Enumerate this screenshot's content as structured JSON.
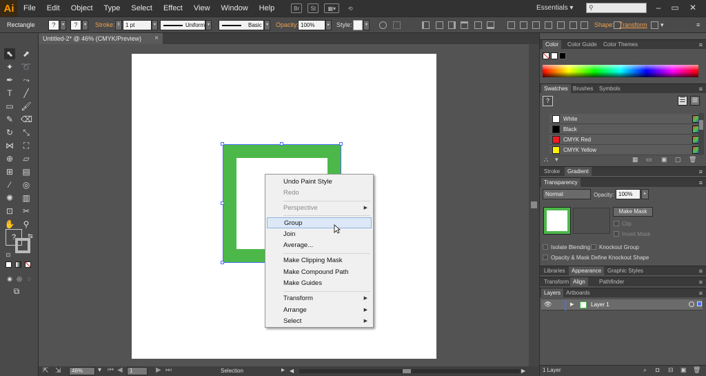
{
  "app": {
    "logo": "Ai",
    "workspace": "Essentials"
  },
  "menubar": {
    "items": [
      "File",
      "Edit",
      "Object",
      "Type",
      "Select",
      "Effect",
      "View",
      "Window",
      "Help"
    ],
    "icons": [
      "bridge-icon",
      "stock-icon",
      "arrange-documents-icon",
      "sync-icon"
    ],
    "bridge": "Br",
    "stock": "St"
  },
  "control": {
    "tool_name": "Rectangle",
    "fill_swatch": "?",
    "stroke_swatch": "?",
    "stroke_label": "Stroke:",
    "stroke_weight": "1 pt",
    "profile": "Uniform",
    "brush": "Basic",
    "opacity_label": "Opacity:",
    "opacity_value": "100%",
    "style_label": "Style:",
    "shape_label": "Shape:",
    "transform_label": "Transform"
  },
  "document": {
    "tab_title": "Untitled-2* @ 46% (CMYK/Preview)",
    "close": "×"
  },
  "status": {
    "zoom": "46%",
    "artboard": "1",
    "mode": "Selection"
  },
  "context_menu": {
    "items": [
      {
        "label": "Undo Paint Style",
        "enabled": true
      },
      {
        "label": "Redo",
        "enabled": false
      },
      {
        "label": "Perspective",
        "enabled": false,
        "submenu": true
      },
      {
        "label": "Group",
        "enabled": true,
        "highlighted": true
      },
      {
        "label": "Join",
        "enabled": true
      },
      {
        "label": "Average...",
        "enabled": true
      },
      {
        "label": "Make Clipping Mask",
        "enabled": true
      },
      {
        "label": "Make Compound Path",
        "enabled": true
      },
      {
        "label": "Make Guides",
        "enabled": true
      },
      {
        "label": "Transform",
        "enabled": true,
        "submenu": true
      },
      {
        "label": "Arrange",
        "enabled": true,
        "submenu": true
      },
      {
        "label": "Select",
        "enabled": true,
        "submenu": true
      }
    ]
  },
  "panels": {
    "color": {
      "tabs": [
        "Color",
        "Color Guide",
        "Color Themes"
      ]
    },
    "swatches": {
      "tabs": [
        "Swatches",
        "Brushes",
        "Symbols"
      ],
      "items": [
        {
          "name": "White",
          "color": "#ffffff"
        },
        {
          "name": "Black",
          "color": "#000000"
        },
        {
          "name": "CMYK Red",
          "color": "#ee1c24"
        },
        {
          "name": "CMYK Yellow",
          "color": "#fff200"
        }
      ]
    },
    "stroke_gradient": {
      "tabs": [
        "Stroke",
        "Gradient"
      ]
    },
    "transparency": {
      "tab": "Transparency",
      "blend_mode": "Normal",
      "opacity_label": "Opacity:",
      "opacity_value": "100%",
      "make_mask": "Make Mask",
      "clip": "Clip",
      "invert_mask": "Invert Mask",
      "isolate_blending": "Isolate Blending",
      "knockout_group": "Knockout Group",
      "opacity_mask": "Opacity & Mask Define Knockout Shape"
    },
    "appearance": {
      "tabs": [
        "Libraries",
        "Appearance",
        "Graphic Styles"
      ]
    },
    "align": {
      "tabs": [
        "Transform",
        "Align",
        "Pathfinder"
      ]
    },
    "layers": {
      "tabs": [
        "Layers",
        "Artboards"
      ],
      "layer_name": "Layer 1",
      "footer": "1 Layer"
    }
  },
  "colors": {
    "fill_green": "#4db84a",
    "selection": "#4a6cf7",
    "accent_orange": "#f0a04a"
  }
}
